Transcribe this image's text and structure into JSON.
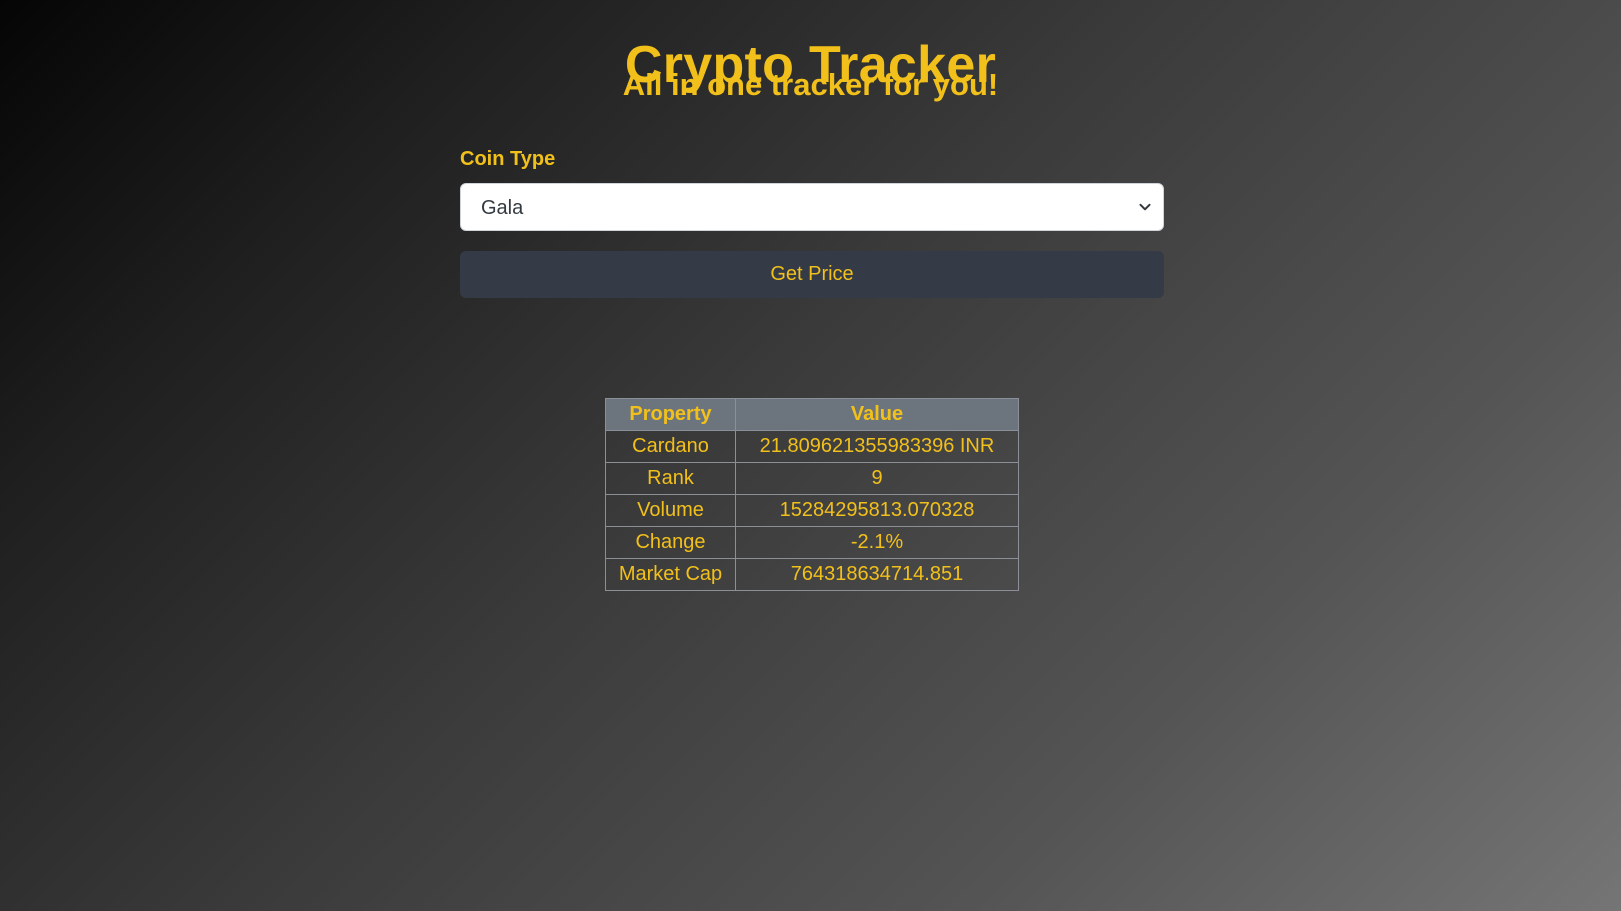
{
  "header": {
    "title": "Crypto Tracker",
    "subtitle": "All in one tracker for you!"
  },
  "form": {
    "coin_label": "Coin Type",
    "coin_selected": "Gala",
    "submit_label": "Get Price"
  },
  "results": {
    "columns": [
      "Property",
      "Value"
    ],
    "rows": [
      {
        "property": "Cardano",
        "value": "21.809621355983396 INR"
      },
      {
        "property": "Rank",
        "value": "9"
      },
      {
        "property": "Volume",
        "value": "15284295813.070328"
      },
      {
        "property": "Change",
        "value": "-2.1%"
      },
      {
        "property": "Market Cap",
        "value": "764318634714.851"
      }
    ]
  },
  "colors": {
    "accent": "#f2c01a",
    "button_bg": "#343a46",
    "table_header_bg": "#6c757d"
  },
  "icons": {
    "select_arrow": "chevron-down-icon"
  }
}
